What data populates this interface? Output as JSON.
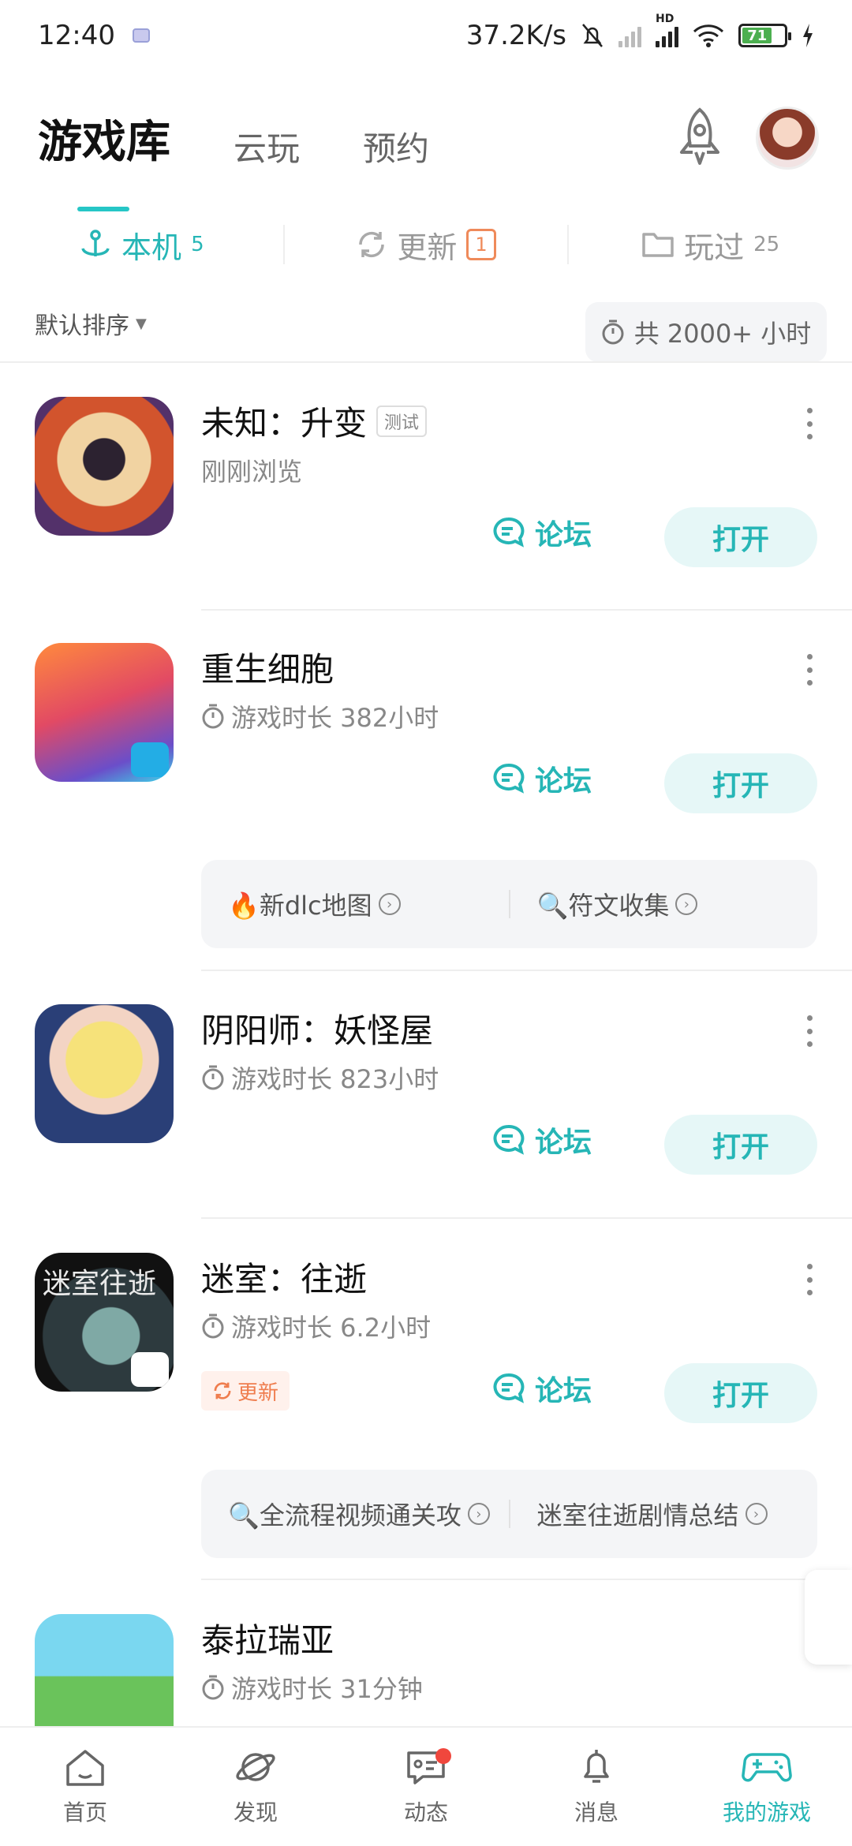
{
  "status_bar": {
    "time": "12:40",
    "net_speed": "37.2K/s",
    "network_label": "HD",
    "battery": "71"
  },
  "top_tabs": [
    "游戏库",
    "云玩",
    "预约"
  ],
  "filters": [
    {
      "label": "本机",
      "count": "5"
    },
    {
      "label": "更新",
      "count": "1"
    },
    {
      "label": "玩过",
      "count": "25"
    }
  ],
  "sort_label": "默认排序",
  "total_time": "共 2000+ 小时",
  "games": [
    {
      "name": "未知：升变",
      "badge": "测试",
      "subtitle": "刚刚浏览",
      "forum": "论坛",
      "open": "打开"
    },
    {
      "name": "重生细胞",
      "subtitle": "游戏时长 382小时",
      "forum": "论坛",
      "open": "打开",
      "extras": [
        "🔥新dlc地图",
        "🔍符文收集"
      ]
    },
    {
      "name": "阴阳师：妖怪屋",
      "subtitle": "游戏时长 823小时",
      "forum": "论坛",
      "open": "打开"
    },
    {
      "name": "迷室：往逝",
      "subtitle": "游戏时长 6.2小时",
      "forum": "论坛",
      "open": "打开",
      "update_tag": "更新",
      "icon_text": "迷室往逝",
      "extras": [
        "🔍全流程视频通关攻",
        "迷室往逝剧情总结"
      ]
    },
    {
      "name": "泰拉瑞亚",
      "subtitle": "游戏时长 31分钟"
    }
  ],
  "bottom_nav": [
    {
      "label": "首页",
      "icon": "home-icon"
    },
    {
      "label": "发现",
      "icon": "planet-icon"
    },
    {
      "label": "动态",
      "icon": "feed-icon"
    },
    {
      "label": "消息",
      "icon": "bell-icon"
    },
    {
      "label": "我的游戏",
      "icon": "gamepad-icon"
    }
  ],
  "colors": {
    "accent": "#26b6b6",
    "update": "#ef7d4e",
    "notification": "#f0473d"
  }
}
